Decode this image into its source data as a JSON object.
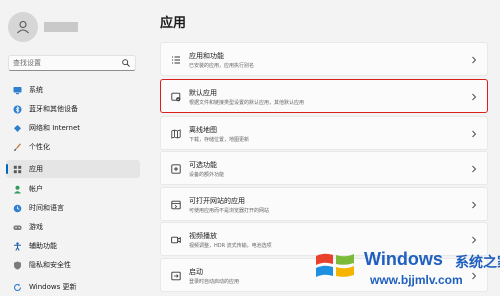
{
  "search": {
    "placeholder": "查找设置"
  },
  "sidebar": {
    "items": [
      {
        "label": "系统",
        "icon": "monitor-icon"
      },
      {
        "label": "蓝牙和其他设备",
        "icon": "bluetooth-icon"
      },
      {
        "label": "网络和 Internet",
        "icon": "wifi-icon"
      },
      {
        "label": "个性化",
        "icon": "brush-icon"
      },
      {
        "label": "应用",
        "icon": "apps-icon",
        "active": true
      },
      {
        "label": "帐户",
        "icon": "person-icon"
      },
      {
        "label": "时间和语言",
        "icon": "globe-clock-icon"
      },
      {
        "label": "游戏",
        "icon": "gamepad-icon"
      },
      {
        "label": "辅助功能",
        "icon": "accessibility-icon"
      },
      {
        "label": "隐私和安全性",
        "icon": "shield-icon"
      },
      {
        "label": "Windows 更新",
        "icon": "update-icon"
      }
    ]
  },
  "main": {
    "title": "应用",
    "cards": [
      {
        "title": "应用和功能",
        "desc": "已安装的应用，应用执行别名",
        "icon": "list-apps-icon"
      },
      {
        "title": "默认应用",
        "desc": "根据文件和链接类型设置的默认应用，其他默认应用",
        "icon": "default-apps-icon",
        "highlighted": true
      },
      {
        "title": "离线地图",
        "desc": "下载，存储位置，地图更新",
        "icon": "map-icon"
      },
      {
        "title": "可选功能",
        "desc": "设备的额外功能",
        "icon": "optional-features-icon"
      },
      {
        "title": "可打开网站的应用",
        "desc": "可使用应用而不是浏览器打开的网站",
        "icon": "web-apps-icon"
      },
      {
        "title": "视频播放",
        "desc": "视频调整，HDR 流式传输，电池选项",
        "icon": "video-icon"
      },
      {
        "title": "启动",
        "desc": "登录时自动启动的应用",
        "icon": "startup-icon"
      }
    ]
  },
  "watermark": {
    "brand": "Windows",
    "brand_cn": "系统之家",
    "site": "www.bjjmlv.com"
  },
  "colors": {
    "accent": "#0067c0",
    "highlight": "#d9201f",
    "watermark": "#1f5fbf"
  }
}
